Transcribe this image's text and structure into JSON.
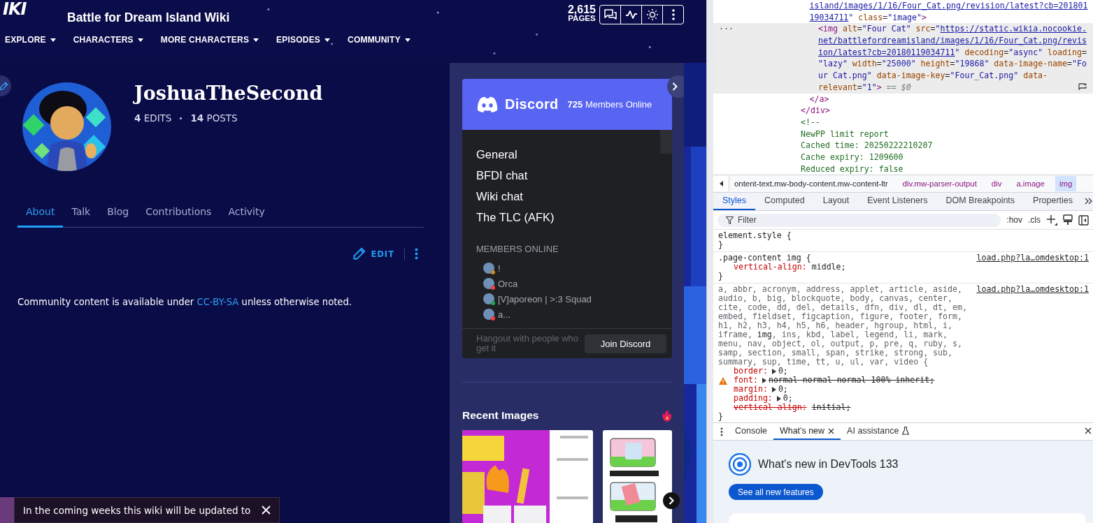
{
  "header": {
    "logo": "IKI",
    "title": "Battle for Dream Island Wiki",
    "nav": [
      {
        "label": "EXPLORE"
      },
      {
        "label": "CHARACTERS"
      },
      {
        "label": "MORE CHARACTERS"
      },
      {
        "label": "EPISODES"
      },
      {
        "label": "COMMUNITY"
      }
    ],
    "page_count": {
      "number": "2,615",
      "label": "PAGES"
    }
  },
  "profile": {
    "username": "JoshuaTheSecond",
    "stats": [
      {
        "count": "4",
        "label": "EDITS"
      },
      {
        "count": "14",
        "label": "POSTS"
      }
    ],
    "tabs": [
      {
        "label": "About",
        "selected": true
      },
      {
        "label": "Talk",
        "selected": false
      },
      {
        "label": "Blog",
        "selected": false
      },
      {
        "label": "Contributions",
        "selected": false
      },
      {
        "label": "Activity",
        "selected": false
      }
    ],
    "edit_label": "EDIT",
    "license": {
      "before": "Community content is available under ",
      "link": "CC-BY-SA",
      "after": " unless otherwise noted."
    },
    "notice": "In the coming weeks this wiki will be updated to"
  },
  "discord": {
    "brand": "Discord",
    "online": {
      "count": "725",
      "label": "Members Online"
    },
    "channels": [
      "General",
      "BFDI chat",
      "Wiki chat",
      "The TLC (AFK)"
    ],
    "members_heading": "MEMBERS ONLINE",
    "members": [
      {
        "name": "!",
        "color": "#c98a2e"
      },
      {
        "name": "Orca",
        "color": "#f23f43"
      },
      {
        "name": "[V]aporeon | >:3 Squad",
        "color": "#23a55a"
      },
      {
        "name": "a...",
        "color": "#f23f43"
      }
    ],
    "tagline": "Hangout with people who get it",
    "join_label": "Join Discord"
  },
  "recent_images": {
    "title": "Recent Images"
  },
  "devtools": {
    "elements": [
      {
        "selected": false,
        "children": [
          {
            "selected": false,
            "lines": [
              [
                {
                  "kind": "link",
                  "text": "island/images/1/16/Four_Cat.png/revision/latest?cb=201801"
                }
              ],
              [
                {
                  "kind": "link",
                  "text": "19034711"
                },
                {
                  "kind": "value",
                  "text": "\""
                },
                {
                  "kind": "attr",
                  "text": " class"
                },
                {
                  "kind": "plain",
                  "text": "="
                },
                {
                  "kind": "value",
                  "text": "\"image\""
                },
                {
                  "kind": "tag",
                  "text": ">"
                }
              ]
            ],
            "children": [
              {
                "selected": true,
                "gutter": "...",
                "lines": [
                  [
                    {
                      "kind": "tag",
                      "text": "<img"
                    },
                    {
                      "kind": "attr",
                      "text": " alt"
                    },
                    {
                      "kind": "plain",
                      "text": "="
                    },
                    {
                      "kind": "value",
                      "text": "\"Four Cat\""
                    },
                    {
                      "kind": "attr",
                      "text": " src"
                    },
                    {
                      "kind": "plain",
                      "text": "="
                    },
                    {
                      "kind": "value",
                      "text": "\""
                    },
                    {
                      "kind": "link",
                      "text": "https://static.wikia.nocookie."
                    }
                  ],
                  [
                    {
                      "kind": "link",
                      "text": "net/battlefordreamisland/images/1/16/Four_Cat.png/revis"
                    }
                  ],
                  [
                    {
                      "kind": "link",
                      "text": "ion/latest?cb=20180119034711"
                    },
                    {
                      "kind": "value",
                      "text": "\""
                    },
                    {
                      "kind": "attr",
                      "text": " decoding"
                    },
                    {
                      "kind": "plain",
                      "text": "="
                    },
                    {
                      "kind": "value",
                      "text": "\"async\""
                    },
                    {
                      "kind": "attr",
                      "text": " loading"
                    },
                    {
                      "kind": "plain",
                      "text": "="
                    }
                  ],
                  [
                    {
                      "kind": "value",
                      "text": "\"lazy\""
                    },
                    {
                      "kind": "attr",
                      "text": " width"
                    },
                    {
                      "kind": "plain",
                      "text": "="
                    },
                    {
                      "kind": "value",
                      "text": "\"25000\""
                    },
                    {
                      "kind": "attr",
                      "text": " height"
                    },
                    {
                      "kind": "plain",
                      "text": "="
                    },
                    {
                      "kind": "value",
                      "text": "\"19868\""
                    },
                    {
                      "kind": "attr",
                      "text": " data-image-name"
                    },
                    {
                      "kind": "plain",
                      "text": "="
                    },
                    {
                      "kind": "value",
                      "text": "\"Fo"
                    }
                  ],
                  [
                    {
                      "kind": "value",
                      "text": "ur Cat.png\""
                    },
                    {
                      "kind": "attr",
                      "text": " data-image-key"
                    },
                    {
                      "kind": "plain",
                      "text": "="
                    },
                    {
                      "kind": "value",
                      "text": "\"Four_Cat.png\""
                    },
                    {
                      "kind": "attr",
                      "text": " data-"
                    }
                  ],
                  [
                    {
                      "kind": "attr",
                      "text": "relevant"
                    },
                    {
                      "kind": "plain",
                      "text": "="
                    },
                    {
                      "kind": "value",
                      "text": "\"1\""
                    },
                    {
                      "kind": "tag",
                      "text": ">"
                    },
                    {
                      "kind": "hint",
                      "text": " == $0"
                    }
                  ]
                ]
              }
            ],
            "close": [
              {
                "kind": "tag",
                "text": "</a>"
              }
            ]
          }
        ],
        "close": [
          {
            "kind": "tag",
            "text": "</div>"
          }
        ]
      },
      {
        "selected": false,
        "lines": [
          [
            {
              "kind": "comment",
              "text": "<!--"
            }
          ],
          [
            {
              "kind": "comment",
              "text": "NewPP limit report"
            }
          ],
          [
            {
              "kind": "comment",
              "text": "Cached time: 20250222210207"
            }
          ],
          [
            {
              "kind": "comment",
              "text": "Cache expiry: 1209600"
            }
          ],
          [
            {
              "kind": "comment",
              "text": "Reduced expiry: false"
            }
          ]
        ]
      }
    ],
    "breadcrumbs": [
      {
        "text": "ontent-text.mw-body-content.mw-content-ltr",
        "kind": "class",
        "selected": false
      },
      {
        "text": "div.mw-parser-output",
        "kind": "tag",
        "selected": false
      },
      {
        "text": "div",
        "kind": "tag",
        "selected": false
      },
      {
        "text": "a.image",
        "kind": "tag",
        "selected": false
      },
      {
        "text": "img",
        "kind": "tag",
        "selected": true
      }
    ],
    "style_tabs": [
      {
        "label": "Styles",
        "selected": true
      },
      {
        "label": "Computed",
        "selected": false
      },
      {
        "label": "Layout",
        "selected": false
      },
      {
        "label": "Event Listeners",
        "selected": false
      },
      {
        "label": "DOM Breakpoints",
        "selected": false
      },
      {
        "label": "Properties",
        "selected": false
      }
    ],
    "filter_placeholder": "Filter",
    "filter_tools": [
      ":hov",
      ".cls"
    ],
    "rules": [
      {
        "selector": "element.style {",
        "dimmed": false,
        "close": "}"
      },
      {
        "selector": ".page-content img {",
        "dimmed": false,
        "source": "load.php?la…omdesktop:1",
        "close": "}",
        "properties": [
          {
            "name": "vertical-align:",
            "value": "middle;",
            "expandable": false,
            "warning": false,
            "name_struck": false,
            "value_struck": false
          }
        ]
      },
      {
        "selector": "a, abbr, acronym, address, applet, article, aside, audio, b, big, blockquote, body, canvas, center, cite, code, dd, del, details, dfn, div, dl, dt, em, embed, fieldset, figcaption, figure, footer, form, h1, h2, h3, h4, h5, h6, header, hgroup, html, i, iframe, **img**, ins, kbd, label, legend, li, mark, menu, nav, object, ol, output, p, pre, q, ruby, s, samp, section, small, span, strike, strong, sub, summary, sup, time, tt, u, ul, var, video {",
        "dimmed": true,
        "source": "load.php?la…omdesktop:1",
        "close": "}",
        "properties": [
          {
            "name": "border:",
            "value": "0;",
            "expandable": true,
            "warning": false,
            "name_struck": false,
            "value_struck": false
          },
          {
            "name": "font:",
            "value": "normal normal normal 100% inherit;",
            "expandable": true,
            "warning": true,
            "name_struck": false,
            "value_struck": true
          },
          {
            "name": "margin:",
            "value": "0;",
            "expandable": true,
            "warning": false,
            "name_struck": false,
            "value_struck": false
          },
          {
            "name": "padding:",
            "value": "0;",
            "expandable": true,
            "warning": false,
            "name_struck": false,
            "value_struck": false
          },
          {
            "name": "vertical-align:",
            "value": "initial;",
            "expandable": false,
            "warning": false,
            "name_struck": true,
            "value_struck": true
          }
        ]
      }
    ],
    "drawer_tabs": [
      {
        "label": "Console",
        "selected": false,
        "kind": "plain"
      },
      {
        "label": "What's new",
        "selected": true,
        "kind": "closable"
      },
      {
        "label": "AI assistance",
        "selected": false,
        "kind": "lab"
      }
    ],
    "whats_new": {
      "title": "What's new in DevTools 133",
      "button": "See all new features"
    }
  }
}
